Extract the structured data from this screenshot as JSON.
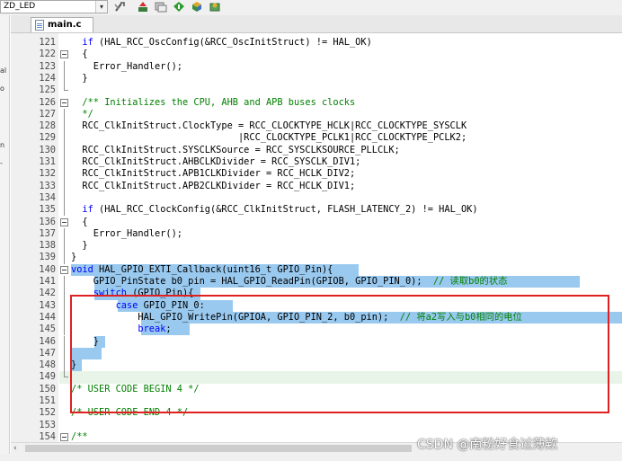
{
  "toolbar": {
    "target_name": "ZD_LED",
    "icons": [
      "target-options-icon",
      "load-icon",
      "pack-installer-icon",
      "manage-run-time-icon",
      "select-software-packs-icon"
    ]
  },
  "left_panel": {
    "chars": [
      "al",
      "o",
      "n",
      "-"
    ]
  },
  "tabs": [
    {
      "label": "main.c"
    }
  ],
  "editor": {
    "lines": [
      {
        "n": "121",
        "code": "  if (HAL_RCC_OscConfig(&RCC_OscInitStruct) != HAL_OK)"
      },
      {
        "n": "122",
        "code": "  {"
      },
      {
        "n": "123",
        "code": "    Error_Handler();"
      },
      {
        "n": "124",
        "code": "  }"
      },
      {
        "n": "125",
        "code": ""
      },
      {
        "n": "126",
        "code": "  /** Initializes the CPU, AHB and APB buses clocks"
      },
      {
        "n": "127",
        "code": "  */"
      },
      {
        "n": "128",
        "code": "  RCC_ClkInitStruct.ClockType = RCC_CLOCKTYPE_HCLK|RCC_CLOCKTYPE_SYSCLK"
      },
      {
        "n": "129",
        "code": "                              |RCC_CLOCKTYPE_PCLK1|RCC_CLOCKTYPE_PCLK2;"
      },
      {
        "n": "130",
        "code": "  RCC_ClkInitStruct.SYSCLKSource = RCC_SYSCLKSOURCE_PLLCLK;"
      },
      {
        "n": "131",
        "code": "  RCC_ClkInitStruct.AHBCLKDivider = RCC_SYSCLK_DIV1;"
      },
      {
        "n": "132",
        "code": "  RCC_ClkInitStruct.APB1CLKDivider = RCC_HCLK_DIV2;"
      },
      {
        "n": "133",
        "code": "  RCC_ClkInitStruct.APB2CLKDivider = RCC_HCLK_DIV1;"
      },
      {
        "n": "134",
        "code": ""
      },
      {
        "n": "135",
        "code": "  if (HAL_RCC_ClockConfig(&RCC_ClkInitStruct, FLASH_LATENCY_2) != HAL_OK)"
      },
      {
        "n": "136",
        "code": "  {"
      },
      {
        "n": "137",
        "code": "    Error_Handler();"
      },
      {
        "n": "138",
        "code": "  }"
      },
      {
        "n": "139",
        "code": "}"
      },
      {
        "n": "140",
        "code": "void HAL_GPIO_EXTI_Callback(uint16_t GPIO_Pin){"
      },
      {
        "n": "141",
        "code": "    GPIO_PinState b0_pin = HAL_GPIO_ReadPin(GPIOB, GPIO_PIN_0);  // 读取b0的状态"
      },
      {
        "n": "142",
        "code": "    switch (GPIO_Pin){"
      },
      {
        "n": "143",
        "code": "        case GPIO_PIN_0:"
      },
      {
        "n": "144",
        "code": "            HAL_GPIO_WritePin(GPIOA, GPIO_PIN_2, b0_pin);  // 将a2写入与b0相同的电位"
      },
      {
        "n": "145",
        "code": "            break;"
      },
      {
        "n": "146",
        "code": "    }"
      },
      {
        "n": "147",
        "code": "    "
      },
      {
        "n": "148",
        "code": "}"
      },
      {
        "n": "149",
        "code": ""
      },
      {
        "n": "150",
        "code": "/* USER CODE BEGIN 4 */"
      },
      {
        "n": "151",
        "code": ""
      },
      {
        "n": "152",
        "code": "/* USER CODE END 4 */"
      },
      {
        "n": "153",
        "code": ""
      },
      {
        "n": "154",
        "code": "/**"
      }
    ]
  },
  "scrollbar": {
    "left_arrow": "‹"
  },
  "watermark": "CSDN @南粉好食过薄欸",
  "colors": {
    "selection": "#99c9ef",
    "highlight_box": "#e02020",
    "comment": "#008000",
    "keyword": "#0000ff"
  }
}
